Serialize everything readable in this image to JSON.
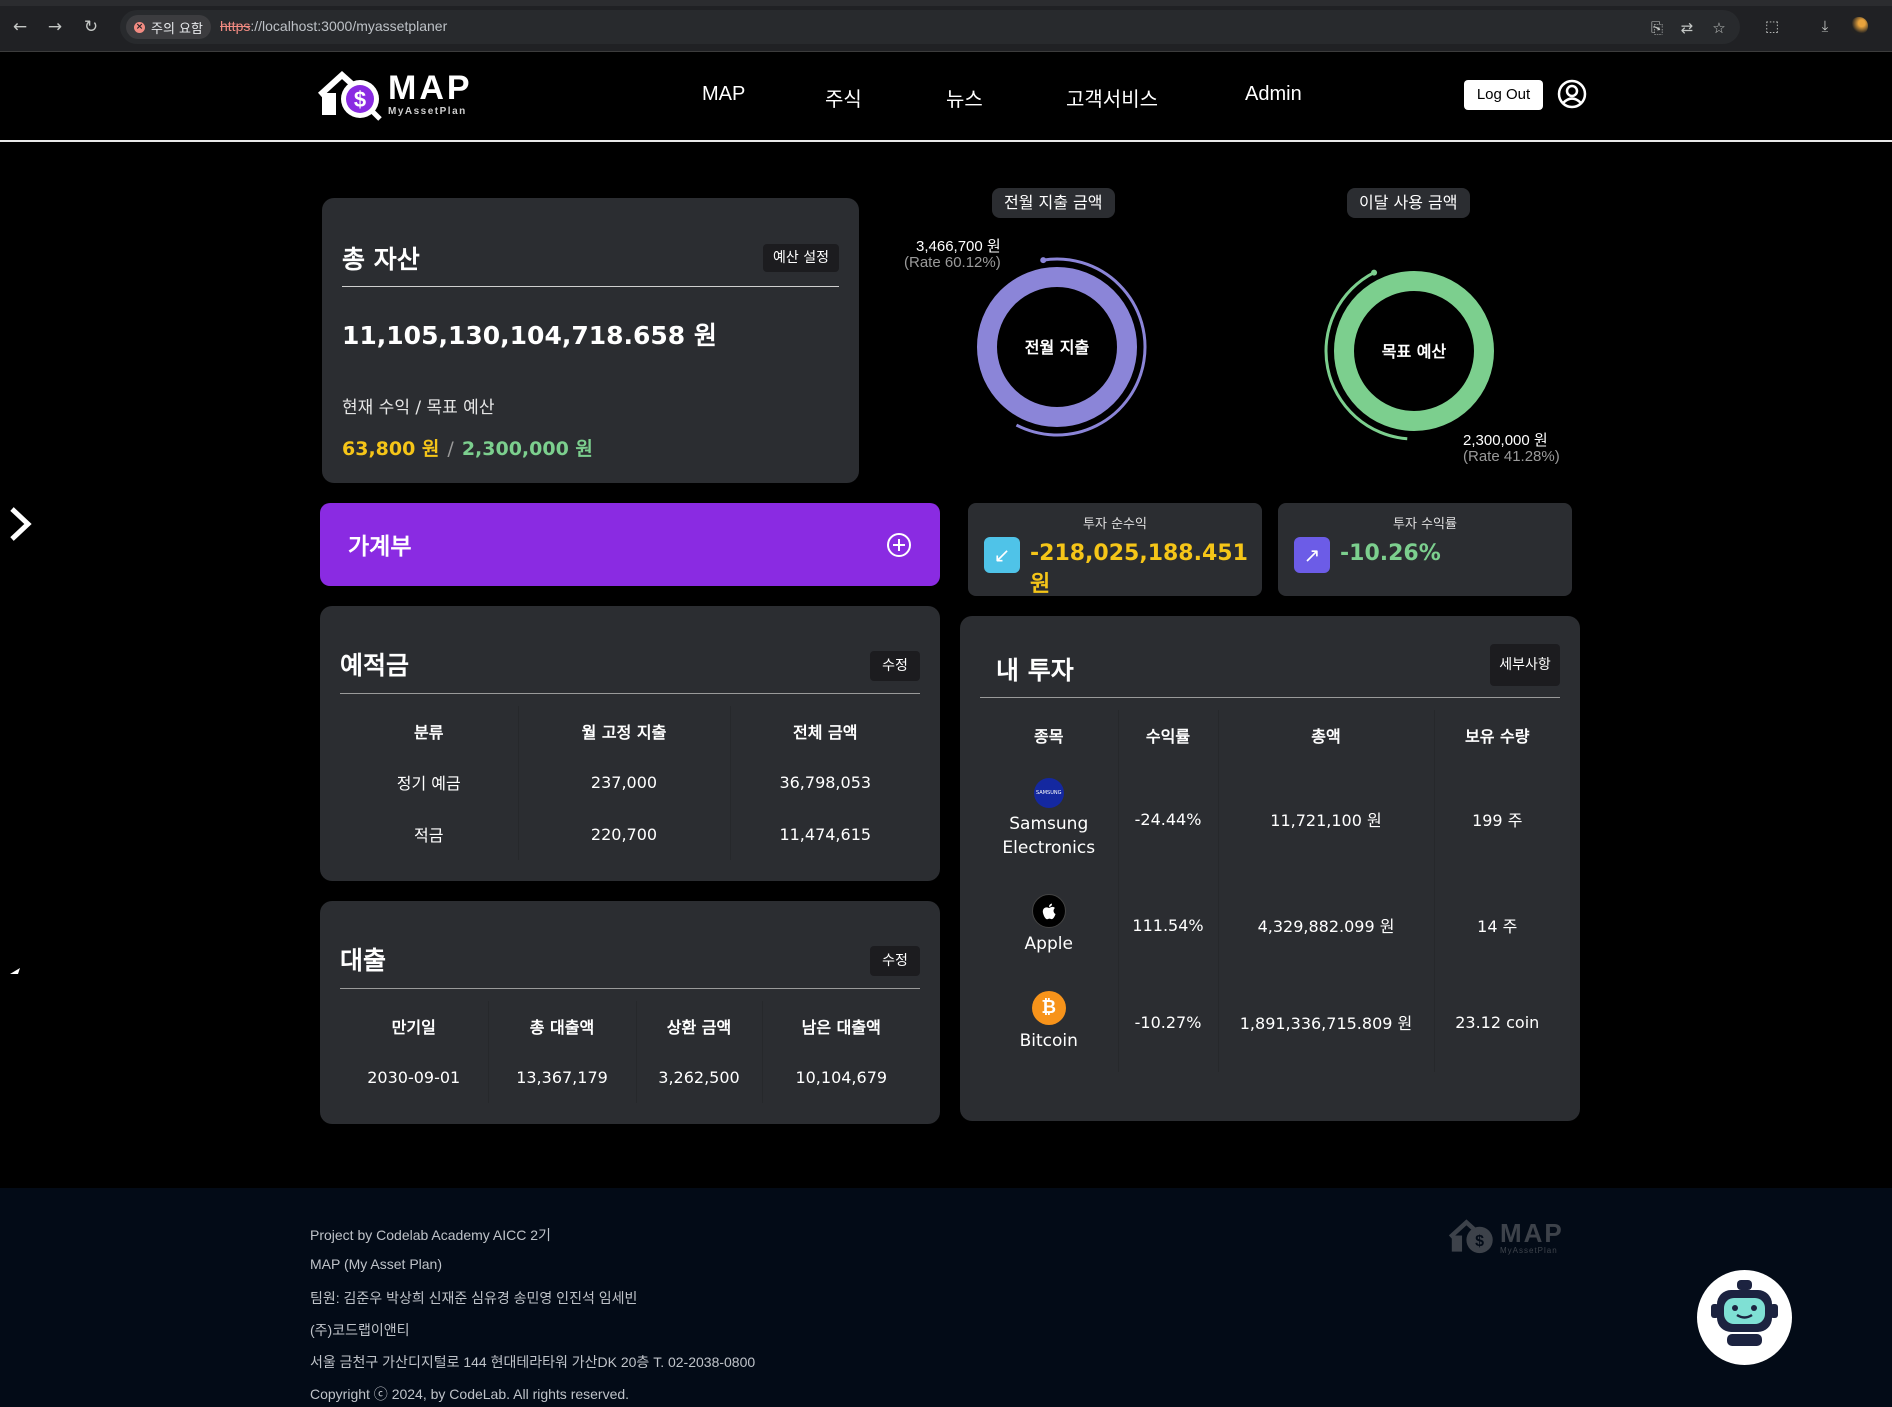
{
  "browser": {
    "warning_chip": "주의 요함",
    "url_scheme": "https",
    "url_rest": "://localhost:3000/myassetplaner"
  },
  "header": {
    "logo_text": "MAP",
    "logo_sub": "MyAssetPlan",
    "nav": [
      "MAP",
      "주식",
      "뉴스",
      "고객서비스",
      "Admin"
    ],
    "logout": "Log Out"
  },
  "total_asset": {
    "title": "총 자산",
    "budget_button": "예산 설정",
    "amount": "11,105,130,104,718.658 원",
    "progress_label": "현재 수익 / 목표 예산",
    "current_income": "63,800 원",
    "separator": "/",
    "target_budget": "2,300,000 원"
  },
  "donut_prev": {
    "pill": "전월 지출 금액",
    "center": "전월 지출",
    "amount": "3,466,700 원",
    "rate": "(Rate 60.12%)",
    "rate_value": 60.12,
    "color": "#8b85d8"
  },
  "donut_current": {
    "pill": "이달 사용 금액",
    "center": "목표 예산",
    "amount": "2,300,000 원",
    "rate": "(Rate 41.28%)",
    "rate_value": 41.28,
    "color": "#7ccf8e"
  },
  "gagyebu": {
    "title": "가계부",
    "icon": "plus-circle-icon"
  },
  "invest_net": {
    "title": "투자 순수익",
    "value": "-218,025,188.451 원",
    "icon": "arrow-down-left-icon",
    "icon_color": "#4fc3e8",
    "value_color": "#f5c518"
  },
  "invest_rate": {
    "title": "투자 수익률",
    "value": "-10.26%",
    "icon": "arrow-up-right-icon",
    "icon_color": "#6c5ce7",
    "value_color": "#7ccf8e"
  },
  "deposits": {
    "title": "예적금",
    "edit": "수정",
    "headers": [
      "분류",
      "월 고정 지출",
      "전체 금액"
    ],
    "rows": [
      [
        "정기 예금",
        "237,000",
        "36,798,053"
      ],
      [
        "적금",
        "220,700",
        "11,474,615"
      ]
    ]
  },
  "loans": {
    "title": "대출",
    "edit": "수정",
    "headers": [
      "만기일",
      "총 대출액",
      "상환 금액",
      "남은 대출액"
    ],
    "rows": [
      [
        "2030-09-01",
        "13,367,179",
        "3,262,500",
        "10,104,679"
      ]
    ]
  },
  "investments": {
    "title": "내 투자",
    "detail": "세부사항",
    "headers": [
      "종목",
      "수익률",
      "총액",
      "보유 수량"
    ],
    "rows": [
      {
        "name": "Samsung Electronics",
        "logo_text": "SAMSUNG",
        "rate": "-24.44%",
        "total": "11,721,100 원",
        "qty": "199 주"
      },
      {
        "name": "Apple",
        "logo_text": "",
        "rate": "111.54%",
        "total": "4,329,882.099 원",
        "qty": "14 주"
      },
      {
        "name": "Bitcoin",
        "logo_text": "₿",
        "rate": "-10.27%",
        "total": "1,891,336,715.809 원",
        "qty": "23.12 coin"
      }
    ]
  },
  "footer": {
    "lines": [
      "Project by Codelab Academy AICC 2기",
      "MAP (My Asset Plan)",
      "팀원: 김준우 박상희 신재준 심유경 송민영 인진석 임세빈",
      "(주)코드랩이앤티",
      "서울 금천구 가산디지털로 144 현대테라타워 가산DK 20층 T. 02-2038-0800",
      "Copyright ⓒ 2024, by CodeLab. All rights reserved."
    ],
    "logo_text": "MAP",
    "logo_sub": "MyAssetPlan"
  }
}
